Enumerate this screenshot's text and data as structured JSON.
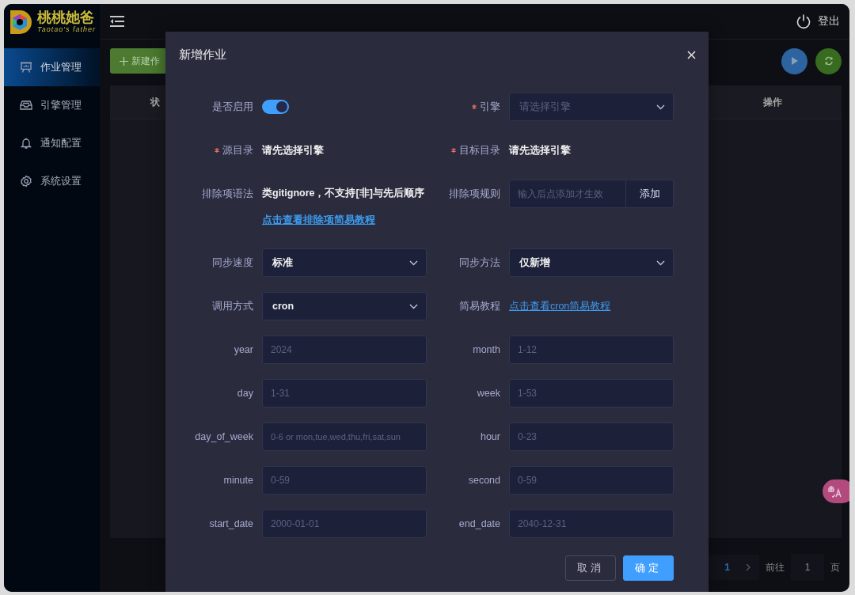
{
  "sidebar": {
    "logo_title": "桃桃她爸",
    "logo_subtitle": "Taotao's father",
    "items": [
      {
        "label": "作业管理",
        "selected": true
      },
      {
        "label": "引擎管理",
        "selected": false
      },
      {
        "label": "通知配置",
        "selected": false
      },
      {
        "label": "系统设置",
        "selected": false
      }
    ]
  },
  "topbar": {
    "logout": "登出"
  },
  "page": {
    "new_button": "新建作",
    "columns": [
      "状",
      "操作"
    ],
    "pagination": {
      "current": "1",
      "goto_label": "前往",
      "goto_value": "1",
      "page_suffix": "页"
    }
  },
  "dialog": {
    "title": "新增作业",
    "fields": [
      {
        "kind": "toggle",
        "label": "是否启用",
        "required": false,
        "on": true
      },
      {
        "kind": "select",
        "label": "引擎",
        "required": true,
        "placeholder": "请选择引擎"
      },
      {
        "kind": "text",
        "label": "源目录",
        "required": true,
        "value": "请先选择引擎"
      },
      {
        "kind": "text",
        "label": "目标目录",
        "required": true,
        "value": "请先选择引擎"
      },
      {
        "kind": "note",
        "label": "排除项语法",
        "required": false,
        "text": "类gitignore，不支持[非]与先后顺序",
        "link": "点击查看排除项简易教程"
      },
      {
        "kind": "input-button",
        "label": "排除项规则",
        "required": false,
        "placeholder": "输入后点添加才生效",
        "button": "添加"
      },
      {
        "kind": "select",
        "label": "同步速度",
        "required": false,
        "value": "标准"
      },
      {
        "kind": "select",
        "label": "同步方法",
        "required": false,
        "value": "仅新增"
      },
      {
        "kind": "select",
        "label": "调用方式",
        "required": false,
        "value": "cron"
      },
      {
        "kind": "link",
        "label": "简易教程",
        "required": false,
        "link": "点击查看cron简易教程"
      },
      {
        "kind": "input",
        "label": "year",
        "required": false,
        "placeholder": "2024"
      },
      {
        "kind": "input",
        "label": "month",
        "required": false,
        "placeholder": "1-12"
      },
      {
        "kind": "input",
        "label": "day",
        "required": false,
        "placeholder": "1-31"
      },
      {
        "kind": "input",
        "label": "week",
        "required": false,
        "placeholder": "1-53"
      },
      {
        "kind": "input",
        "label": "day_of_week",
        "required": false,
        "placeholder": "0-6 or mon,tue,wed,thu,fri,sat,sun"
      },
      {
        "kind": "input",
        "label": "hour",
        "required": false,
        "placeholder": "0-23"
      },
      {
        "kind": "input",
        "label": "minute",
        "required": false,
        "placeholder": "0-59"
      },
      {
        "kind": "input",
        "label": "second",
        "required": false,
        "placeholder": "0-59"
      },
      {
        "kind": "input",
        "label": "start_date",
        "required": false,
        "placeholder": "2000-01-01"
      },
      {
        "kind": "input",
        "label": "end_date",
        "required": false,
        "placeholder": "2040-12-31"
      }
    ],
    "buttons": [
      {
        "label": "取消",
        "kind": "secondary"
      },
      {
        "label": "确定",
        "kind": "primary"
      }
    ]
  }
}
